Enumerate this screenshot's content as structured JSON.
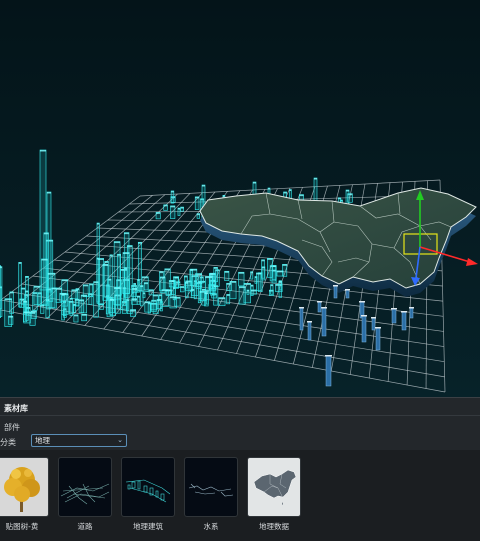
{
  "panel": {
    "title": "素材库",
    "section_label": "部件",
    "category_label": "分类",
    "category_value": "地理"
  },
  "items": [
    {
      "label": "贴图树-黄",
      "icon": "yellow-tree-thumbnail"
    },
    {
      "label": "道路",
      "icon": "road-network-thumbnail"
    },
    {
      "label": "地理建筑",
      "icon": "geo-building-thumbnail"
    },
    {
      "label": "水系",
      "icon": "water-system-thumbnail"
    },
    {
      "label": "地理数据",
      "icon": "china-map-thumbnail"
    }
  ],
  "colors": {
    "viewport_bg": "#051920",
    "grid": "#c8d2d6",
    "building_cyan": "#28e3e6",
    "map_fill": "#2f4a3e",
    "gizmo_x": "#ff2a2a",
    "gizmo_y": "#22cc22",
    "gizmo_z": "#2f6bff",
    "selection_box": "#e6e619"
  }
}
